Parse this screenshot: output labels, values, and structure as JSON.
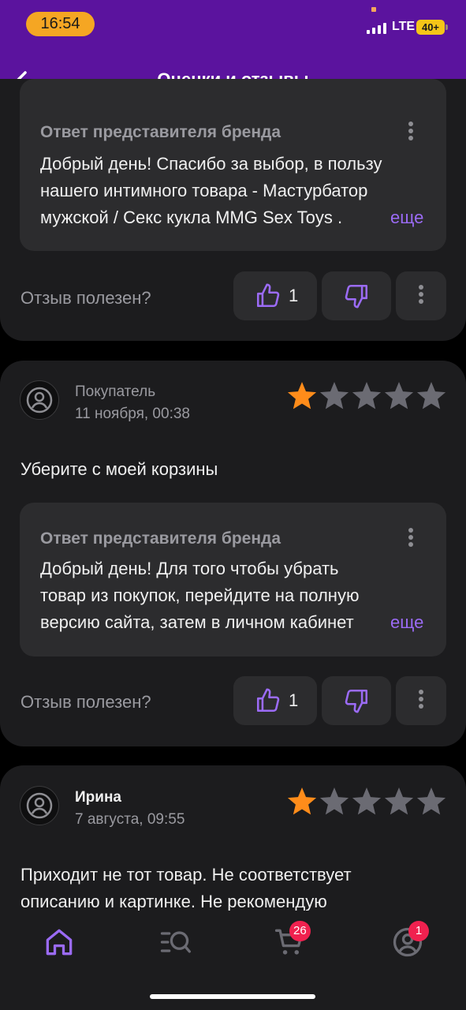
{
  "status_bar": {
    "time": "16:54",
    "network": "LTE",
    "battery": "40+"
  },
  "header": {
    "title": "Оценки и отзывы"
  },
  "reviews": [
    {
      "reply": {
        "title": "Ответ представителя бренда",
        "lines": [
          "Добрый день! Спасибо за выбор, в пользу",
          "нашего интимного товара - Мастурбатор",
          "мужской / Секс кукла MMG Sex Toys ."
        ],
        "more": "еще"
      },
      "helpful_label": "Отзыв полезен?",
      "likes": "1"
    },
    {
      "author": "Покупатель",
      "date": "11 ноября, 00:38",
      "rating": 1,
      "text": "Уберите с моей корзины",
      "reply": {
        "title": "Ответ представителя бренда",
        "lines": [
          "Добрый день!  Для того чтобы убрать",
          "товар из покупок, перейдите на полную",
          "версию сайта, затем в личном кабинет"
        ],
        "more": "еще"
      },
      "helpful_label": "Отзыв полезен?",
      "likes": "1"
    },
    {
      "author": "Ирина",
      "date": "7 августа, 09:55",
      "rating": 1,
      "text_lines": [
        "Приходит не тот товар. Не соответствует",
        "описанию и картинке. Не рекомендую"
      ]
    }
  ],
  "bottom_nav": {
    "items": [
      {
        "icon": "home-icon",
        "active": true
      },
      {
        "icon": "catalog-search-icon"
      },
      {
        "icon": "cart-icon",
        "badge": "26"
      },
      {
        "icon": "profile-icon",
        "badge": "1"
      }
    ]
  },
  "colors": {
    "header": "#5b139e",
    "accent": "#9b6bf5",
    "star_active": "#ff8c1a",
    "star_inactive": "#6b6b73",
    "badge": "#f0214f"
  }
}
